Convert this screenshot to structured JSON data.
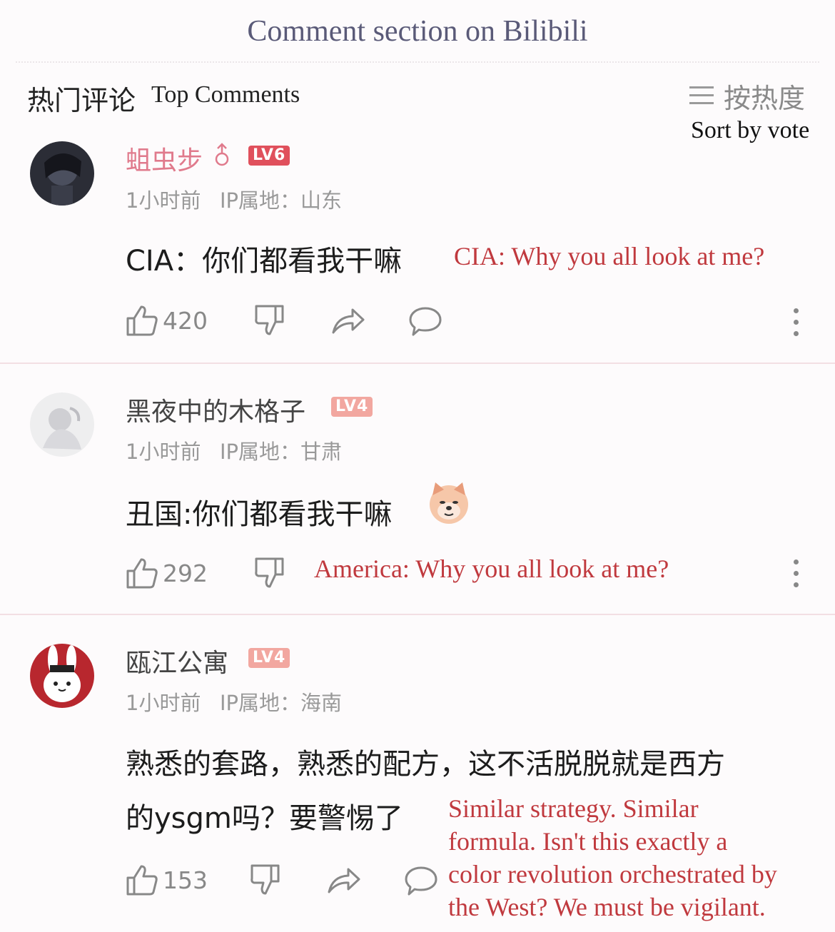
{
  "header": {
    "caption": "Comment section on Bilibili",
    "section_title": "热门评论",
    "section_title_en": "Top Comments",
    "sort_label": "按热度",
    "sort_label_en": "Sort by vote"
  },
  "colors": {
    "accent_red": "#c0393e",
    "username_pink": "#e07a8c",
    "lv6": "#e0505c",
    "lv4": "#f2a7a0"
  },
  "comments": [
    {
      "username": "蛆虫步",
      "level": "LV6",
      "time": "1小时前",
      "ip": "IP属地：山东",
      "text": "CIA：你们都看我干嘛",
      "translation": "CIA: Why you all look at me?",
      "likes": "420"
    },
    {
      "username": "黑夜中的木格子",
      "level": "LV4",
      "time": "1小时前",
      "ip": "IP属地：甘肃",
      "text": "丑国:你们都看我干嘛",
      "translation": "America: Why you all look at me?",
      "likes": "292"
    },
    {
      "username": "瓯江公寓",
      "level": "LV4",
      "time": "1小时前",
      "ip": "IP属地：海南",
      "text_line1": "熟悉的套路，熟悉的配方，这不活脱脱就是西方",
      "text_line2": "的ysgm吗？要警惕了",
      "translation_line1": "Similar strategy. Similar",
      "translation_line2": "formula. Isn't this exactly a",
      "translation_line3": "color revolution orchestrated by",
      "translation_line4": "the West? We must be vigilant.",
      "likes": "153"
    }
  ]
}
